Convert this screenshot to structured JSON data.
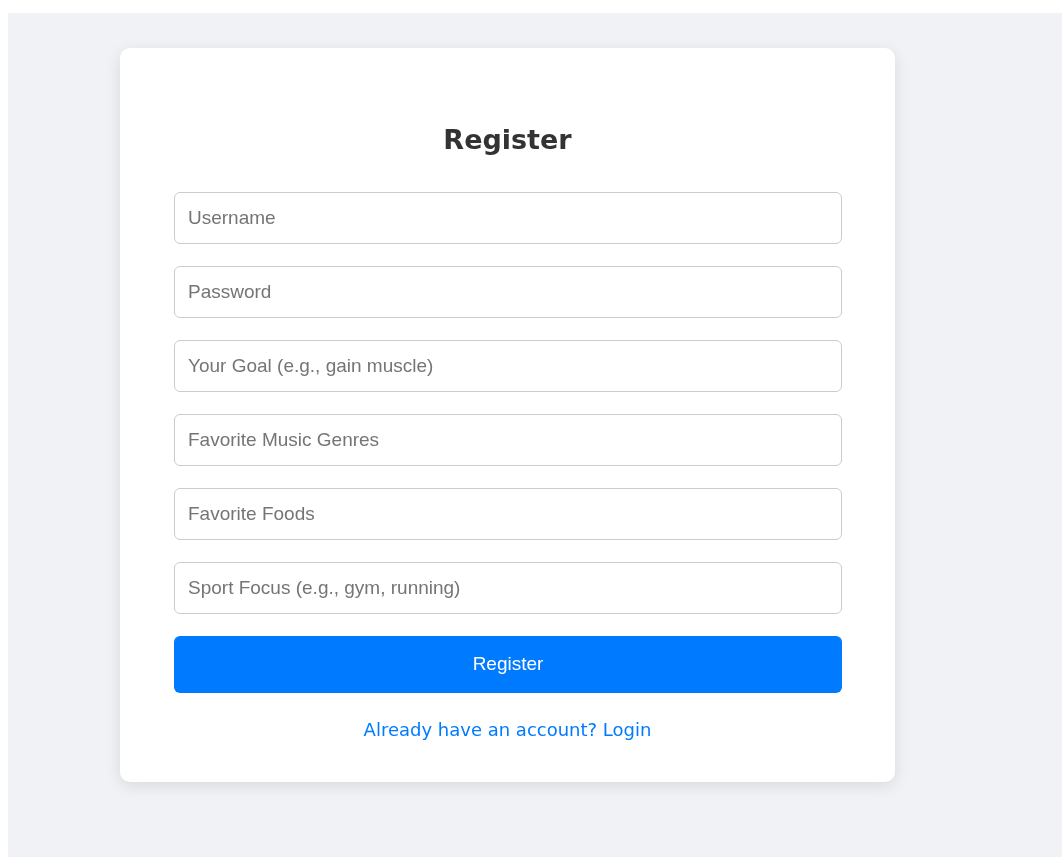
{
  "title": "Register",
  "fields": [
    {
      "placeholder": "Username"
    },
    {
      "placeholder": "Password"
    },
    {
      "placeholder": "Your Goal (e.g., gain muscle)"
    },
    {
      "placeholder": "Favorite Music Genres"
    },
    {
      "placeholder": "Favorite Foods"
    },
    {
      "placeholder": "Sport Focus (e.g., gym, running)"
    }
  ],
  "button": "Register",
  "link": "Already have an account? Login"
}
